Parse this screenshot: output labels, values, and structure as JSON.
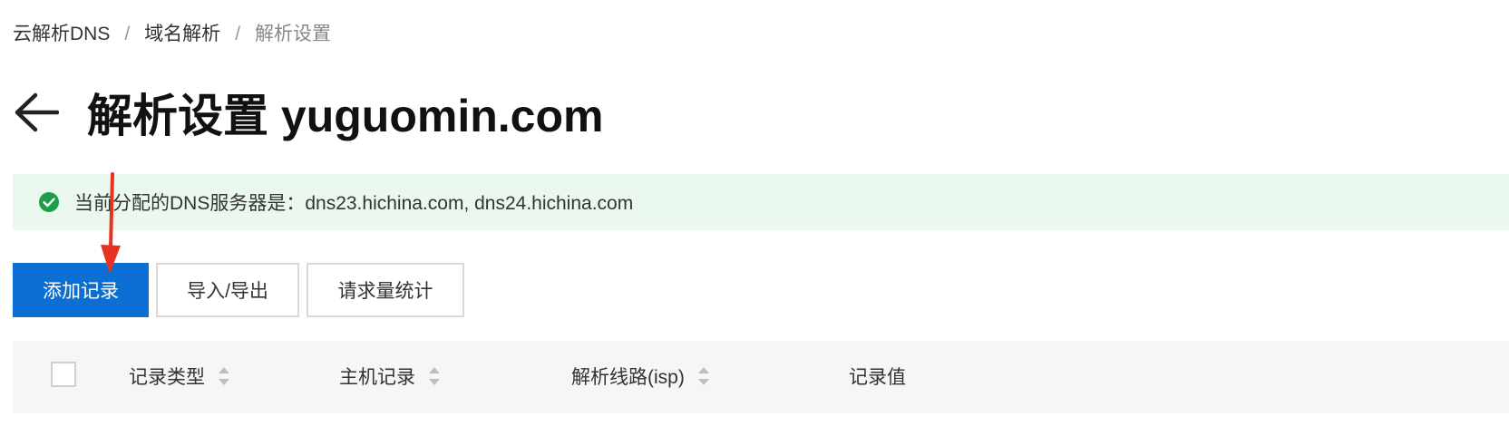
{
  "breadcrumb": {
    "items": [
      "云解析DNS",
      "域名解析",
      "解析设置"
    ],
    "separator": "/"
  },
  "header": {
    "title": "解析设置 yuguomin.com"
  },
  "notice": {
    "text": "当前分配的DNS服务器是：dns23.hichina.com, dns24.hichina.com",
    "icon": "check-circle-icon",
    "background": "#ebf8ee",
    "icon_color": "#1e9e4a"
  },
  "toolbar": {
    "add_label": "添加记录",
    "import_export_label": "导入/导出",
    "stats_label": "请求量统计",
    "primary_color": "#0b6fd3"
  },
  "table": {
    "columns": [
      "记录类型",
      "主机记录",
      "解析线路(isp)",
      "记录值"
    ]
  },
  "annotation": {
    "icon": "red-arrow-down",
    "color": "#e8321f"
  }
}
